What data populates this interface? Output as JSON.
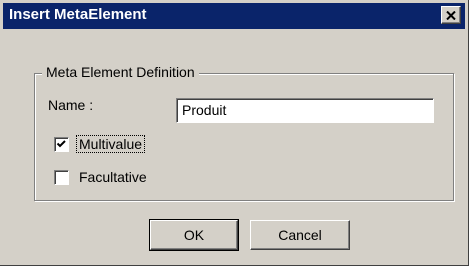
{
  "window": {
    "title": "Insert MetaElement"
  },
  "group": {
    "legend": "Meta Element Definition"
  },
  "name_field": {
    "label": "Name :",
    "value": "Produit"
  },
  "checkboxes": [
    {
      "label": "Multivalue",
      "checked": true,
      "focused": true
    },
    {
      "label": "Facultative",
      "checked": false,
      "focused": false
    }
  ],
  "buttons": {
    "ok": "OK",
    "cancel": "Cancel"
  },
  "icons": {
    "close": "close-icon",
    "check": "checkmark-icon"
  }
}
